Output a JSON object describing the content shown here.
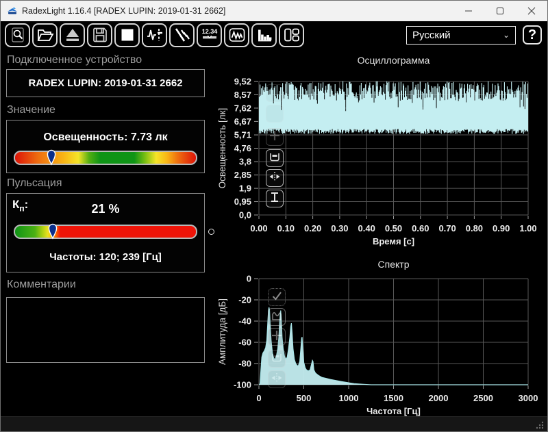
{
  "window": {
    "title": "RadexLight 1.16.4 [RADEX LUPIN: 2019-01-31 2662]",
    "controls": [
      "minimize",
      "maximize",
      "close"
    ]
  },
  "toolbar": {
    "icons": [
      "search-device",
      "open-file",
      "eject-device",
      "save-file",
      "stop-measurement",
      "pulsation-view",
      "flicker-view",
      "value-display-view",
      "oscillogram-view",
      "spectrum-view",
      "layout-view"
    ],
    "language": {
      "value": "Русский"
    },
    "help_label": "?"
  },
  "panels": {
    "device": {
      "header": "Подключенное устройство",
      "value": "RADEX LUPIN: 2019-01-31 2662"
    },
    "value": {
      "header": "Значение",
      "reading": "Освещенность: 7.73 лк",
      "marker_percent": 20,
      "gradient_stops": [
        [
          "#dd1408",
          0
        ],
        [
          "#ee6f10",
          13
        ],
        [
          "#f9b616",
          27
        ],
        [
          "#f5e428",
          35
        ],
        [
          "#53ae12",
          41
        ],
        [
          "#0f9416",
          47
        ],
        [
          "#0f9416",
          66
        ],
        [
          "#7cc013",
          72
        ],
        [
          "#f5e428",
          78
        ],
        [
          "#f9b616",
          84
        ],
        [
          "#ee6f10",
          90
        ],
        [
          "#dd1408",
          100
        ]
      ]
    },
    "pulsation": {
      "header": "Пульсация",
      "kp_base": "К",
      "kp_sub": "п",
      "kp_colon": ":",
      "value": "21 %",
      "marker_percent": 21,
      "frequencies": "Частоты: 120; 239 [Гц]",
      "gradient_stops": [
        [
          "#0f9416",
          0
        ],
        [
          "#4cb013",
          11
        ],
        [
          "#a8cf12",
          15
        ],
        [
          "#e8e020",
          18
        ],
        [
          "#ffc400",
          20
        ],
        [
          "#fb7d00",
          22
        ],
        [
          "#ef1408",
          25
        ],
        [
          "#ef1408",
          100
        ]
      ]
    },
    "comments": {
      "header": "Комментарии",
      "value": ""
    }
  },
  "chart_data": {
    "accent_color": "#c4eef1",
    "grid_color": "#585858",
    "oscillogram": {
      "type": "line",
      "title": "Осциллограмма",
      "ylabel": "Освещенность [лк]",
      "xlabel": "Время [с]",
      "yticks": [
        "9,52",
        "8,57",
        "7,62",
        "6,67",
        "5,71",
        "4,76",
        "3,8",
        "2,85",
        "1,9",
        "0,95",
        "0,0"
      ],
      "ytick_values": [
        9.52,
        8.57,
        7.62,
        6.67,
        5.71,
        4.76,
        3.8,
        2.85,
        1.9,
        0.95,
        0.0
      ],
      "xticks": [
        "0.00",
        "0.10",
        "0.20",
        "0.30",
        "0.40",
        "0.50",
        "0.60",
        "0.70",
        "0.80",
        "0.90",
        "1.00"
      ],
      "xtick_values": [
        0,
        0.1,
        0.2,
        0.3,
        0.4,
        0.5,
        0.6,
        0.7,
        0.8,
        0.9,
        1.0
      ],
      "ylim": [
        0,
        9.52
      ],
      "xlim": [
        0,
        1
      ],
      "signal": {
        "base": 5.78,
        "peak_min": 8.15,
        "peak_max": 9.55,
        "n": 380,
        "seed": 9
      }
    },
    "spectrum": {
      "type": "area",
      "title": "Спектр",
      "ylabel": "Амплитуда [дБ]",
      "xlabel": "Частота [Гц]",
      "yticks": [
        "0",
        "-20",
        "-40",
        "-60",
        "-80",
        "-100"
      ],
      "ytick_values": [
        0,
        -20,
        -40,
        -60,
        -80,
        -100
      ],
      "xticks": [
        "0",
        "500",
        "1000",
        "1500",
        "2000",
        "2500",
        "3000"
      ],
      "xtick_values": [
        0,
        500,
        1000,
        1500,
        2000,
        2500,
        3000
      ],
      "ylim": [
        -100,
        0
      ],
      "xlim": [
        0,
        3000
      ],
      "points": [
        [
          0,
          -100
        ],
        [
          12,
          -99
        ],
        [
          22,
          -86
        ],
        [
          32,
          -74
        ],
        [
          45,
          -70
        ],
        [
          60,
          -68
        ],
        [
          75,
          -65
        ],
        [
          88,
          -58
        ],
        [
          98,
          -43
        ],
        [
          106,
          -30
        ],
        [
          112,
          -27
        ],
        [
          118,
          -30
        ],
        [
          126,
          -44
        ],
        [
          136,
          -58
        ],
        [
          150,
          -70
        ],
        [
          165,
          -75
        ],
        [
          180,
          -76
        ],
        [
          195,
          -73
        ],
        [
          210,
          -66
        ],
        [
          222,
          -55
        ],
        [
          230,
          -42
        ],
        [
          238,
          -32
        ],
        [
          243,
          -30
        ],
        [
          250,
          -40
        ],
        [
          258,
          -55
        ],
        [
          270,
          -66
        ],
        [
          285,
          -73
        ],
        [
          300,
          -76
        ],
        [
          315,
          -74
        ],
        [
          330,
          -66
        ],
        [
          345,
          -55
        ],
        [
          355,
          -45
        ],
        [
          362,
          -42
        ],
        [
          370,
          -52
        ],
        [
          380,
          -66
        ],
        [
          395,
          -76
        ],
        [
          410,
          -80
        ],
        [
          425,
          -82
        ],
        [
          440,
          -82
        ],
        [
          455,
          -78
        ],
        [
          468,
          -65
        ],
        [
          476,
          -56
        ],
        [
          481,
          -55
        ],
        [
          488,
          -66
        ],
        [
          500,
          -79
        ],
        [
          515,
          -84
        ],
        [
          530,
          -86
        ],
        [
          550,
          -87
        ],
        [
          570,
          -86
        ],
        [
          585,
          -81
        ],
        [
          596,
          -77
        ],
        [
          602,
          -78
        ],
        [
          612,
          -86
        ],
        [
          630,
          -89
        ],
        [
          660,
          -91
        ],
        [
          700,
          -93
        ],
        [
          750,
          -94
        ],
        [
          800,
          -95
        ],
        [
          860,
          -96
        ],
        [
          920,
          -97
        ],
        [
          990,
          -98
        ],
        [
          1060,
          -99
        ],
        [
          1150,
          -99.5
        ],
        [
          1250,
          -100
        ],
        [
          1400,
          -100
        ],
        [
          1700,
          -100
        ],
        [
          2100,
          -100
        ],
        [
          2600,
          -100
        ],
        [
          3000,
          -100
        ]
      ]
    }
  }
}
